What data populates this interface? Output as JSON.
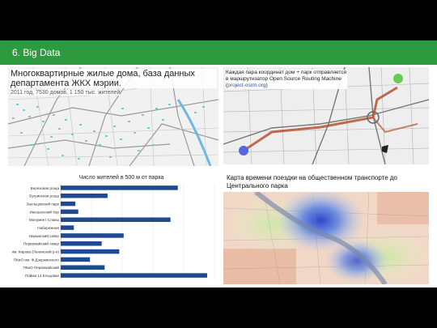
{
  "header": {
    "title": "6.  Big Data",
    "accent": "#2e9a3f"
  },
  "panel_housing": {
    "title": "Многоквартирные жилые дома, база данных департамента ЖКХ мэрии.",
    "subtitle": "2011 год,     7530 домов,     1 150 тыс. жителей"
  },
  "panel_routing": {
    "text": "Каждая пара координат дом + парк отправляется в маршрутизатор Open Source Routing Machine (",
    "link": "project-osrm.org",
    "text_end": ")"
  },
  "panel_travel": {
    "caption": "Карта времени поездки на общественном транспорте до Центрального парка"
  },
  "chart_data": {
    "type": "bar",
    "orientation": "horizontal",
    "title": "Число жителей в 500 м от парка",
    "categories": [
      "Березовая роща",
      "Бугринская роща",
      "Заельцовский парк",
      "Инюшенский бор",
      "Монумент Славы",
      "Набережная",
      "Нарымский сквер",
      "Первомайский сквер",
      "им. Кирова (Ленинский р-н)",
      "ПКиО им. Ф.Дзержинского",
      "ПКиО Первомайский",
      "Пойма 14 Ельцовки"
    ],
    "values": [
      80,
      32,
      10,
      12,
      75,
      9,
      43,
      28,
      40,
      20,
      30,
      100
    ],
    "xlim": [
      0,
      105
    ],
    "color": "#1f4a8f",
    "grid": true
  }
}
